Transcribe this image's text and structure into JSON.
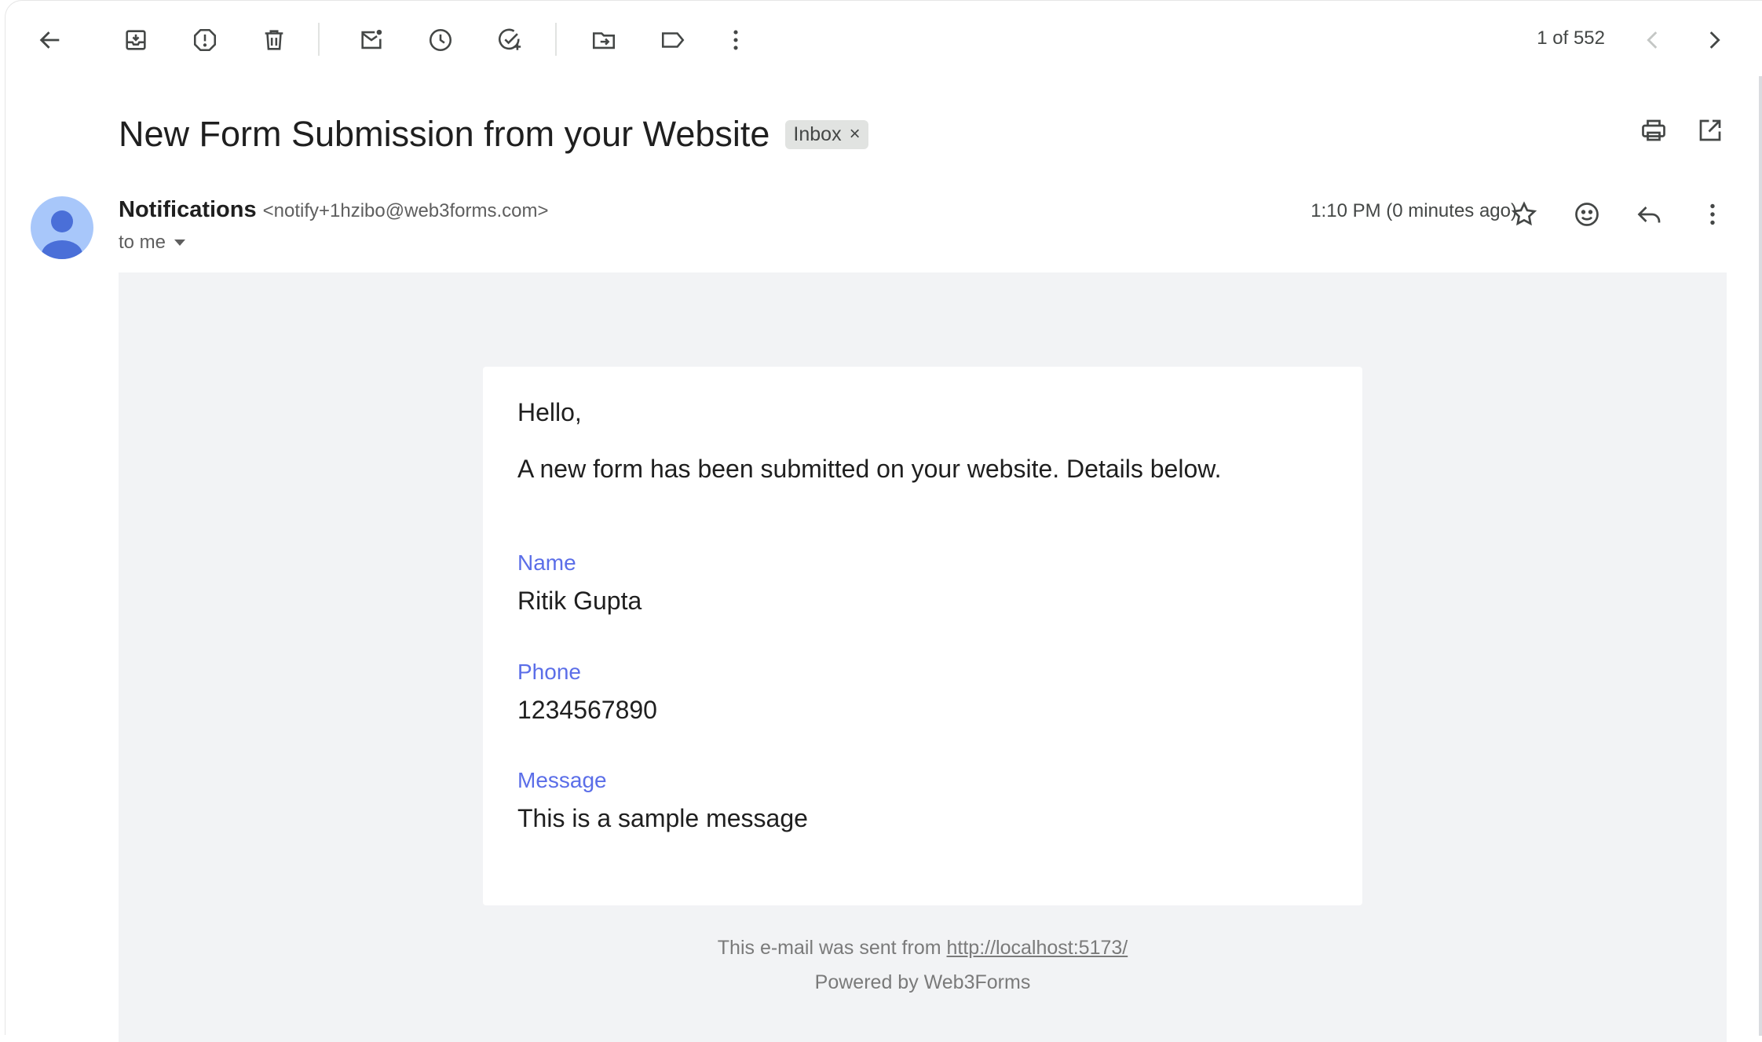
{
  "toolbar": {
    "icons": [
      "back-arrow-icon",
      "archive-icon",
      "report-spam-icon",
      "delete-icon",
      "mark-unread-icon",
      "snooze-icon",
      "add-task-icon",
      "move-to-icon",
      "label-icon",
      "more-vertical-icon"
    ],
    "pager": "1 of 552"
  },
  "subject": {
    "title": "New Form Submission from your Website",
    "label": "Inbox",
    "label_remove": "×"
  },
  "message": {
    "sender_name": "Notifications",
    "sender_email": "<notify+1hzibo@web3forms.com>",
    "to": "to me",
    "time": "1:10 PM (0 minutes ago)"
  },
  "email": {
    "greeting": "Hello,",
    "intro": "A new form has been submitted on your website. Details below.",
    "fields": [
      {
        "label": "Name",
        "value": "Ritik Gupta"
      },
      {
        "label": "Phone",
        "value": "1234567890"
      },
      {
        "label": "Message",
        "value": "This is a sample message"
      }
    ],
    "footer_prefix": "This e-mail was sent from ",
    "footer_link": "http://localhost:5173/",
    "footer_powered": "Powered by Web3Forms"
  },
  "colors": {
    "field_label": "#5b6ee8",
    "body_bg": "#f2f3f5",
    "avatar_bg": "#a8c7fa",
    "avatar_fg": "#4a6fd8"
  }
}
